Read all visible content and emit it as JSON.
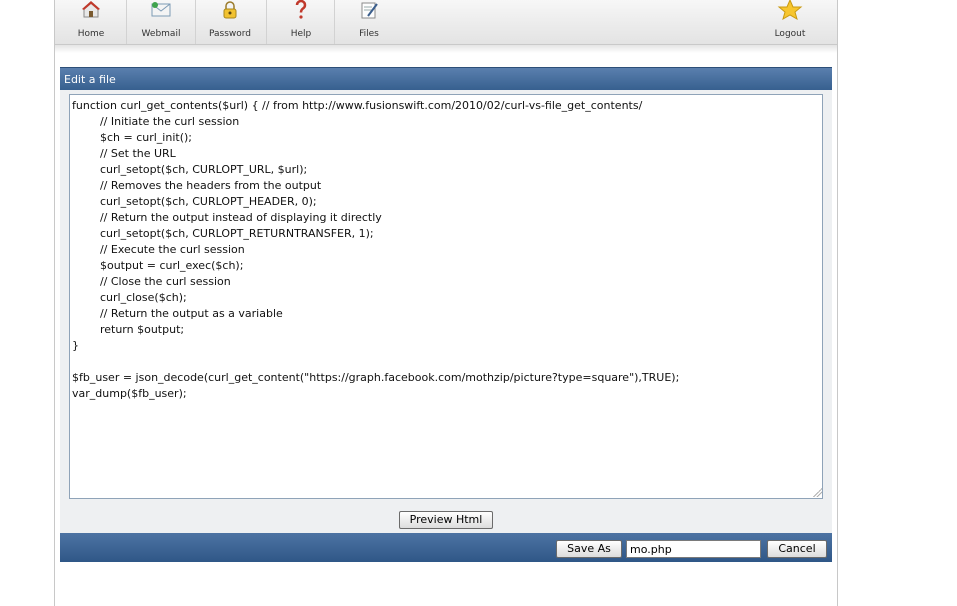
{
  "toolbar": {
    "items": [
      {
        "label": "Home",
        "icon": "home-icon"
      },
      {
        "label": "Webmail",
        "icon": "mail-icon"
      },
      {
        "label": "Password",
        "icon": "lock-icon"
      },
      {
        "label": "Help",
        "icon": "help-icon"
      },
      {
        "label": "Files",
        "icon": "files-icon"
      }
    ],
    "logout": {
      "label": "Logout",
      "icon": "star-icon"
    }
  },
  "panel": {
    "title": "Edit a file",
    "content": "function curl_get_contents($url) { // from http://www.fusionswift.com/2010/02/curl-vs-file_get_contents/\n        // Initiate the curl session\n        $ch = curl_init();\n        // Set the URL\n        curl_setopt($ch, CURLOPT_URL, $url);\n        // Removes the headers from the output\n        curl_setopt($ch, CURLOPT_HEADER, 0);\n        // Return the output instead of displaying it directly\n        curl_setopt($ch, CURLOPT_RETURNTRANSFER, 1);\n        // Execute the curl session\n        $output = curl_exec($ch);\n        // Close the curl session\n        curl_close($ch);\n        // Return the output as a variable\n        return $output;\n}\n\n$fb_user = json_decode(curl_get_content(\"https://graph.facebook.com/mothzip/picture?type=square\"),TRUE);\nvar_dump($fb_user);"
  },
  "buttons": {
    "preview": "Preview Html",
    "save_as": "Save As",
    "cancel": "Cancel"
  },
  "filename_value": "mo.php",
  "colors": {
    "header_blue": "#3a6392",
    "panel_bg": "#eef0f2"
  }
}
